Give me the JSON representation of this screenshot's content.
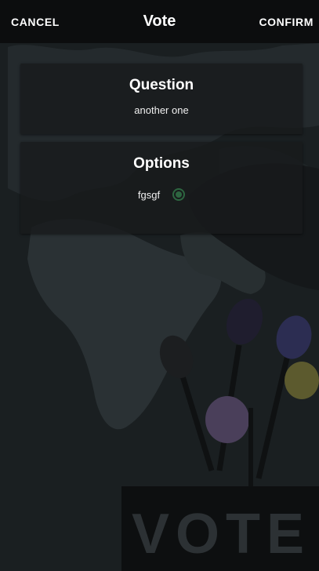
{
  "header": {
    "cancel_label": "CANCEL",
    "title": "Vote",
    "confirm_label": "CONFIRM"
  },
  "question": {
    "heading": "Question",
    "text": "another one"
  },
  "options": {
    "heading": "Options",
    "items": [
      {
        "label": "fgsgf",
        "selected": true
      }
    ]
  },
  "background": {
    "poster_text": "VOTE"
  },
  "colors": {
    "radio_accent": "#2d6640",
    "header_bg": "#0c0d0e"
  }
}
